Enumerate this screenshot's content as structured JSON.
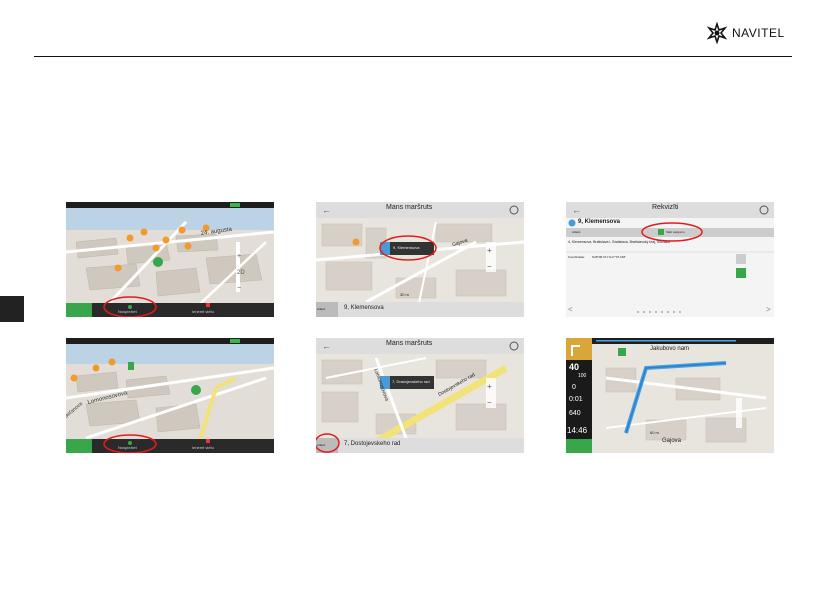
{
  "brand": {
    "logo_text": "NAVITEL"
  },
  "screens": {
    "s1": {
      "bottom_left": "Nospiežiet",
      "bottom_right": "Ieņemt vietu"
    },
    "s2": {
      "bottom_left": "Nospiežiet",
      "bottom_right": "Ieņemt vietu"
    },
    "s3": {
      "title": "Mans maršruts",
      "popup": "9, Klemensova",
      "street1": "Gajova",
      "scale": "30 m",
      "address": "9, Klemensova",
      "btn": "Atlasīt"
    },
    "s4": {
      "title": "Mans maršruts",
      "popup": "7, Dostojevskeho rad",
      "street1": "Dostojevskeho rad",
      "street2": "Lomonosovova",
      "address": "7, Dostojevskeho rad",
      "btn": "Atlasīt"
    },
    "s5": {
      "title": "Rekvizīti",
      "heading": "9, Klemensova",
      "row_left": "Atlasīt",
      "row_right": "Sākt ceļojumu",
      "addr_line": "4, Klemensova, Bratislava I, Bratislava, Bratislavský kraj, Slovakia",
      "coord_label": "Koordinātas:",
      "coord_val": "N48°08.471' E17°07.168'"
    },
    "s6": {
      "speed": "40",
      "limit": "100",
      "dist1": "0",
      "time1": "0:01",
      "dist2": "640",
      "clock": "14:46",
      "street_top": "Jakubovo nam",
      "street_bot": "Gajova",
      "scale": "60 m"
    }
  }
}
